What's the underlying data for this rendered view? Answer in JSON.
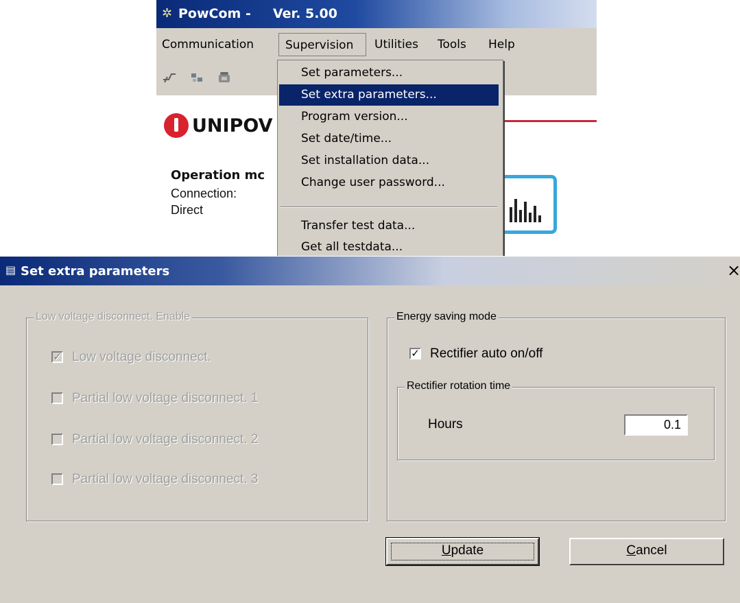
{
  "main_window": {
    "app_name": "PowCom -",
    "version": "Ver. 5.00",
    "menu": [
      "Communication",
      "Supervision",
      "Utilities",
      "Tools",
      "Help"
    ],
    "active_menu": "Supervision",
    "supervision_menu": [
      "Set parameters...",
      "Set extra parameters...",
      "Program version...",
      "Set date/time...",
      "Set installation data...",
      "Change user password...",
      "Transfer test data...",
      "Get all testdata..."
    ],
    "selected_menu_item": "Set extra parameters...",
    "logo_text": "UNIPOV",
    "operation_mode_label": "Operation mc",
    "connection_label": "Connection:",
    "connection_value": "Direct",
    "accent_red": "#c8283a",
    "accent_blue": "#36a8dc"
  },
  "dialog": {
    "title": "Set extra parameters",
    "close_glyph": "×",
    "lvd_group": {
      "title": "Low voltage disconnect. Enable",
      "items": [
        {
          "label": "Low voltage disconnect.",
          "checked": true,
          "enabled": false
        },
        {
          "label": "Partial low voltage disconnect. 1",
          "checked": false,
          "enabled": false
        },
        {
          "label": "Partial low voltage disconnect. 2",
          "checked": false,
          "enabled": false
        },
        {
          "label": "Partial low voltage disconnect. 3",
          "checked": false,
          "enabled": false
        }
      ]
    },
    "energy_group": {
      "title": "Energy saving mode",
      "rectifier_auto": {
        "label": "Rectifier auto on/off",
        "checked": true
      },
      "rotation_group": {
        "title": "Rectifier rotation time",
        "hours_label": "Hours",
        "hours_value": "0.1"
      }
    },
    "buttons": {
      "update": {
        "mnemonic": "U",
        "rest": "pdate"
      },
      "cancel": {
        "mnemonic": "C",
        "rest": "ancel"
      }
    }
  }
}
